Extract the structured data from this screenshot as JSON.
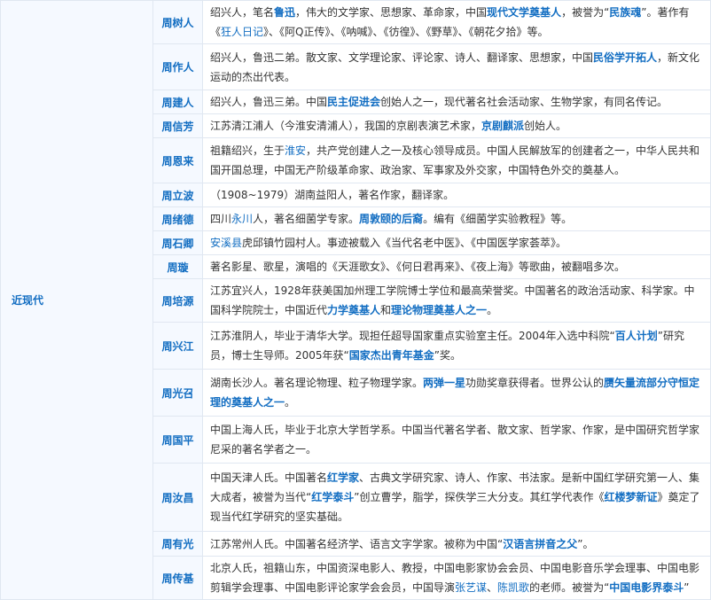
{
  "era_label": "近现代",
  "rows": [
    {
      "name": "周树人",
      "h": 44,
      "parts": [
        {
          "t": "绍兴人，笔名"
        },
        {
          "l": "鲁迅",
          "b": true
        },
        {
          "t": "，伟大的文学家、思想家、革命家，中国"
        },
        {
          "l": "现代文学奠基人",
          "b": true
        },
        {
          "t": "，被誉为“"
        },
        {
          "l": "民族魂",
          "b": true
        },
        {
          "t": "”。著作有《"
        },
        {
          "l": "狂人日记"
        },
        {
          "t": "》、《阿Q正传》、《呐喊》、《彷徨》、《野草》、《朝花夕拾》等。"
        }
      ]
    },
    {
      "name": "周作人",
      "h": 52,
      "parts": [
        {
          "t": "绍兴人，鲁迅二弟。散文家、文学理论家、评论家、诗人、翻译家、思想家，中国"
        },
        {
          "l": "民俗学开拓人",
          "b": true
        },
        {
          "t": "，新文化运动的杰出代表。"
        }
      ]
    },
    {
      "name": "周建人",
      "h": 27,
      "parts": [
        {
          "t": "绍兴人，鲁迅三弟。中国"
        },
        {
          "l": "民主促进会",
          "b": true
        },
        {
          "t": "创始人之一，现代著名社会活动家、生物学家，有同名传记。"
        }
      ]
    },
    {
      "name": "周信芳",
      "h": 26,
      "parts": [
        {
          "t": "江苏清江浦人（今淮安清浦人），我国的京剧表演艺术家，"
        },
        {
          "l": "京剧麒派",
          "b": true
        },
        {
          "t": "创始人。"
        }
      ]
    },
    {
      "name": "周恩来",
      "h": 51,
      "parts": [
        {
          "t": "祖籍绍兴，生于"
        },
        {
          "l": "淮安"
        },
        {
          "t": "，共产党创建人之一及核心领导成员。中国人民解放军的创建者之一，中华人民共和国开国总理，中国无产阶级革命家、政治家、军事家及外交家，中国特色外交的奠基人。"
        }
      ]
    },
    {
      "name": "周立波",
      "h": 27,
      "parts": [
        {
          "t": "（1908~1979）湖南益阳人，著名作家，翻译家。"
        }
      ]
    },
    {
      "name": "周绪德",
      "h": 27,
      "parts": [
        {
          "t": "四川"
        },
        {
          "l": "永川"
        },
        {
          "t": "人，著名细菌学专家。"
        },
        {
          "l": "周敦颐的后裔",
          "b": true
        },
        {
          "t": "。编有《细菌学实验教程》等。"
        }
      ]
    },
    {
      "name": "周石卿",
      "h": 26,
      "parts": [
        {
          "l": "安溪县"
        },
        {
          "t": "虎邱镇竹园村人。事迹被载入《当代名老中医》、《中国医学家荟萃》。"
        }
      ]
    },
    {
      "name": "周璇",
      "h": 27,
      "parts": [
        {
          "t": "著名影星、歌星，演唱的《天涯歌女》、《何日君再来》、《夜上海》等歌曲，被翻唱多次。"
        }
      ]
    },
    {
      "name": "周培源",
      "h": 44,
      "parts": [
        {
          "t": "江苏宜兴人，1928年获美国加州理工学院博士学位和最高荣誉奖。中国著名的政治活动家、科学家。中国科学院院士，中国近代"
        },
        {
          "l": "力学奠基人",
          "b": true
        },
        {
          "t": "和"
        },
        {
          "l": "理论物理奠基人之一",
          "b": true
        },
        {
          "t": "。"
        }
      ]
    },
    {
      "name": "周兴江",
      "h": 53,
      "parts": [
        {
          "t": "江苏淮阴人，毕业于清华大学。现担任超导国家重点实验室主任。2004年入选中科院“"
        },
        {
          "l": "百人计划",
          "b": true
        },
        {
          "t": "”研究员，博士生导师。2005年获“"
        },
        {
          "l": "国家杰出青年基金",
          "b": true
        },
        {
          "t": "”奖。"
        }
      ]
    },
    {
      "name": "周光召",
      "h": 53,
      "parts": [
        {
          "t": "湖南长沙人。著名理论物理、粒子物理学家。"
        },
        {
          "l": "两弹一星",
          "b": true
        },
        {
          "t": "功勋奖章获得者。世界公认的"
        },
        {
          "l": "赝矢量流部分守恒定理的奠基人之一",
          "b": true
        },
        {
          "t": "。"
        }
      ]
    },
    {
      "name": "周国平",
      "h": 53,
      "parts": [
        {
          "t": "中国上海人氏，毕业于北京大学哲学系。中国当代著名学者、散文家、哲学家、作家，是中国研究哲学家尼采的著名学者之一。"
        }
      ]
    },
    {
      "name": "周汝昌",
      "h": 77,
      "parts": [
        {
          "t": "中国天津人氏。中国著名"
        },
        {
          "l": "红学家",
          "b": true
        },
        {
          "t": "、古典文学研究家、诗人、作家、书法家。是新中国红学研究第一人、集大成者，被誉为当代“"
        },
        {
          "l": "红学泰斗",
          "b": true
        },
        {
          "t": "”创立曹学，脂学，探佚学三大分支。其红学代表作《"
        },
        {
          "l": "红楼梦新证",
          "b": true
        },
        {
          "t": "》奠定了现当代红学研究的坚实基础。"
        }
      ]
    },
    {
      "name": "周有光",
      "h": 28,
      "parts": [
        {
          "t": "江苏常州人氏。中国著名经济学、语言文字学家。被称为中国“"
        },
        {
          "l": "汉语言拼音之父",
          "b": true
        },
        {
          "t": "”。"
        }
      ]
    },
    {
      "name": "周传基",
      "h": 48,
      "parts": [
        {
          "t": "北京人氏，祖籍山东，中国资深电影人、教授，中国电影家协会会员、中国电影音乐学会理事、中国电影剪辑学会理事、中国电影评论家学会会员，中国导演"
        },
        {
          "l": "张艺谋"
        },
        {
          "t": "、"
        },
        {
          "l": "陈凯歌"
        },
        {
          "t": "的老师。被誉为“"
        },
        {
          "l": "中国电影界泰斗",
          "b": true
        },
        {
          "t": "”"
        }
      ]
    }
  ]
}
